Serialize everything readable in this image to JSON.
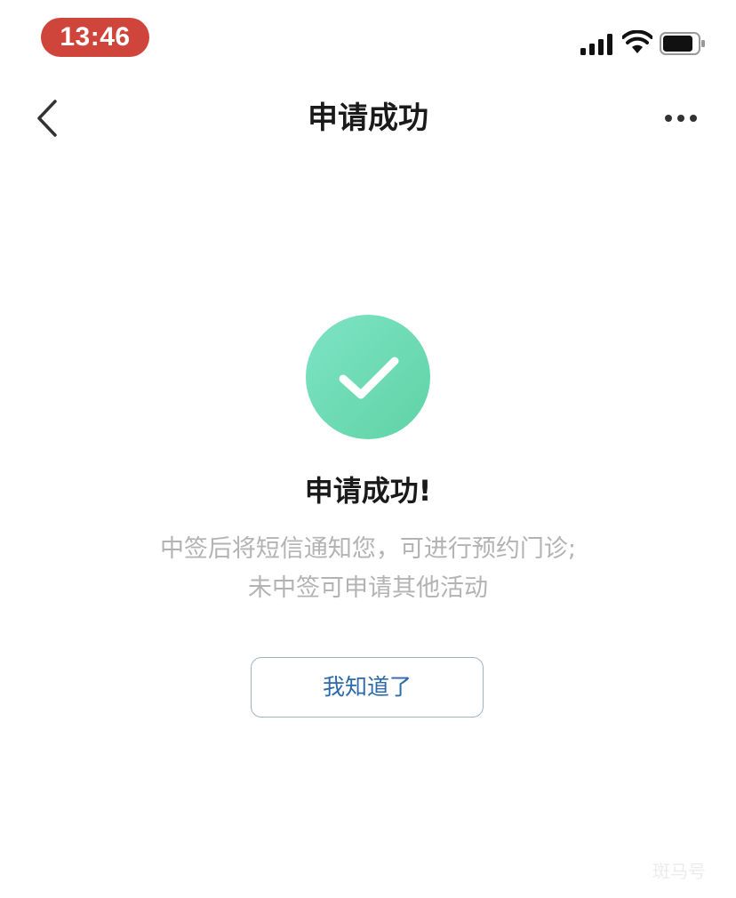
{
  "status_bar": {
    "time": "13:46",
    "time_pill_color": "#d0453b",
    "signal_icon": "cellular-signal-icon",
    "wifi_icon": "wifi-icon",
    "battery_icon": "battery-icon"
  },
  "nav": {
    "title": "申请成功",
    "back_icon": "chevron-left-icon",
    "more_icon": "more-horizontal-icon"
  },
  "result": {
    "icon": "check-circle-icon",
    "icon_color": "#6fdcb8",
    "title": "申请成功!",
    "description_lines": [
      "中签后将短信通知您，可进行预约门诊;",
      "未中签可申请其他活动"
    ]
  },
  "actions": {
    "ack_label": "我知道了"
  },
  "watermark": "斑马号"
}
